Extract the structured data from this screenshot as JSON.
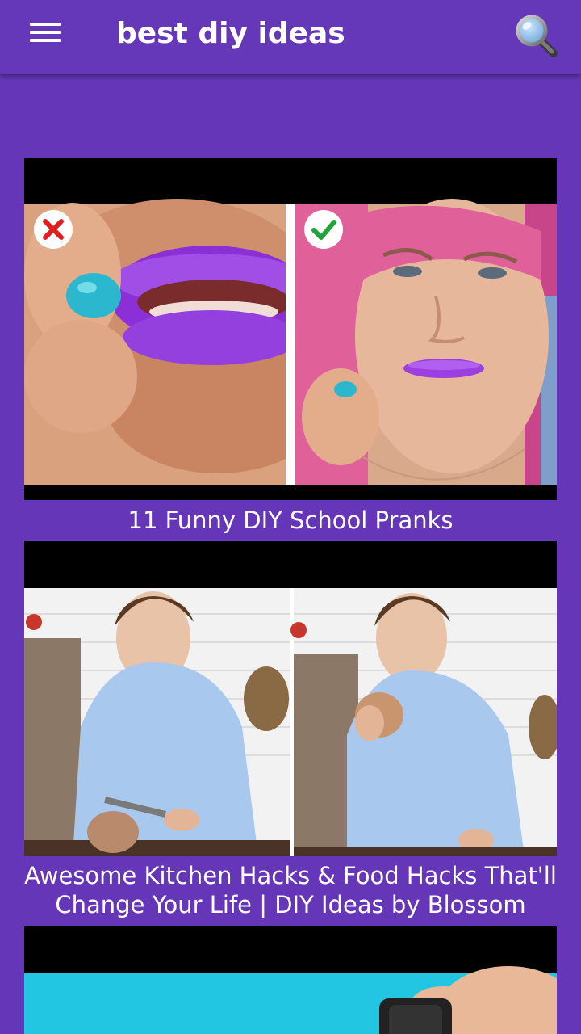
{
  "appbar": {
    "title": "best diy ideas",
    "background": "#6538b9",
    "menu_icon": "hamburger-menu-icon",
    "search_icon": "search-icon"
  },
  "feed": {
    "background": "#6537b8",
    "videos": [
      {
        "title": "11 Funny DIY School Pranks",
        "thumbnail": "split-image: purple lips with blue putty (red X) / pink-haired woman with purple lips (green check)"
      },
      {
        "title": "Awesome Kitchen Hacks & Food Hacks That'll Change Your Life | DIY Ideas by Blossom",
        "title_line1": "Awesome Kitchen Hacks & Food Hacks That'll",
        "title_line2": "Change Your Life | DIY Ideas by Blossom",
        "thumbnail": "split-image: woman cutting a coconut / woman holding a coconut"
      },
      {
        "title": "",
        "thumbnail": "cyan background with hand holding a black object"
      }
    ]
  }
}
